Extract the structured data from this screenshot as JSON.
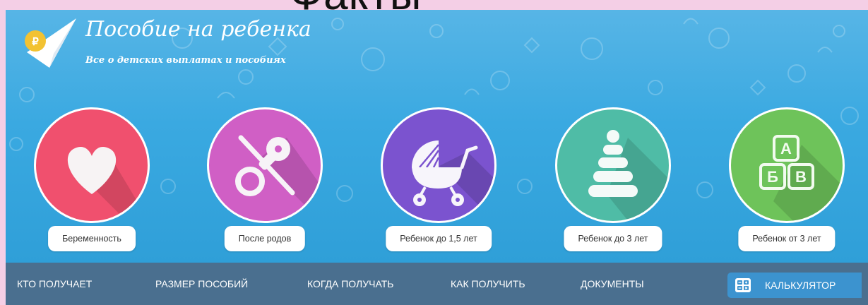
{
  "overlay_text": "Факты",
  "site": {
    "title": "Пособие на ребенка",
    "subtitle": "Все о детских выплатах и пособиях"
  },
  "categories": [
    {
      "label": "Беременность",
      "icon": "heart-icon",
      "color": "#f0506e"
    },
    {
      "label": "После родов",
      "icon": "pacifier-icon",
      "color": "#d05fc5"
    },
    {
      "label": "Ребенок до 1,5 лет",
      "icon": "stroller-icon",
      "color": "#7b53cf"
    },
    {
      "label": "Ребенок до 3 лет",
      "icon": "pyramid-toy-icon",
      "color": "#4fbca6"
    },
    {
      "label": "Ребенок от 3 лет",
      "icon": "abc-blocks-icon",
      "color": "#6ec35a"
    }
  ],
  "blocks_letters": [
    "А",
    "Б",
    "В"
  ],
  "nav": {
    "items": [
      "КТО ПОЛУЧАЕТ",
      "РАЗМЕР ПОСОБИЙ",
      "КОГДА ПОЛУЧАТЬ",
      "КАК ПОЛУЧИТЬ",
      "ДОКУМЕНТЫ"
    ],
    "calculator_label": "КАЛЬКУЛЯТОР",
    "calculator_icon": "calculator-icon"
  },
  "colors": {
    "hero": "#3aa9e1",
    "nav": "#4a6f8f",
    "calculator": "#3c93cf",
    "page_background": "#f4cfe6"
  }
}
